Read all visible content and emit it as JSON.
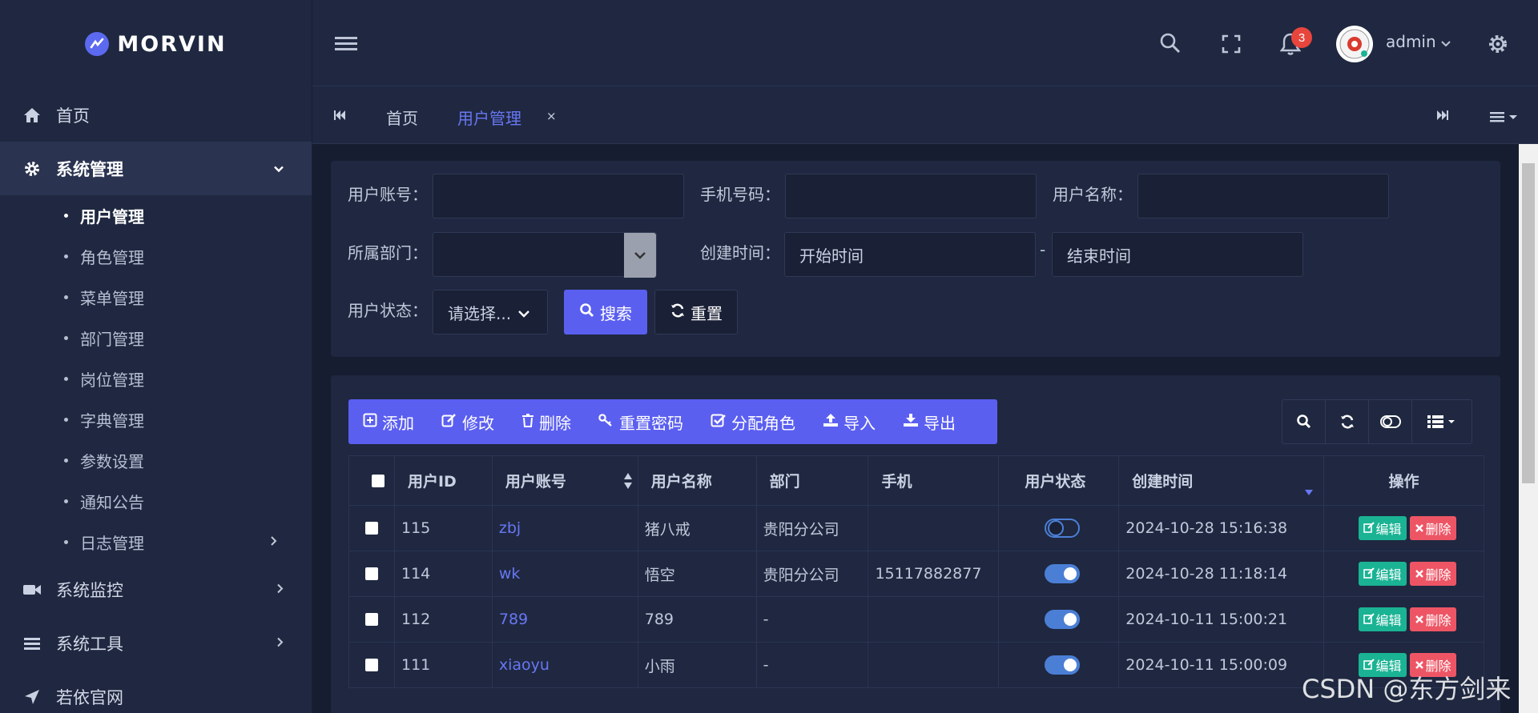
{
  "app": {
    "brand": "MORVIN",
    "accent_color": "#5b5ff0"
  },
  "sidebar": {
    "items": [
      {
        "label": "首页",
        "icon": "home-icon"
      },
      {
        "label": "系统管理",
        "icon": "gear-icon",
        "expanded": true,
        "children": [
          "用户管理",
          "角色管理",
          "菜单管理",
          "部门管理",
          "岗位管理",
          "字典管理",
          "参数设置",
          "通知公告",
          "日志管理"
        ]
      },
      {
        "label": "系统监控",
        "icon": "video-icon"
      },
      {
        "label": "系统工具",
        "icon": "list-icon"
      },
      {
        "label": "若依官网",
        "icon": "send-icon"
      }
    ]
  },
  "header": {
    "notification_count": "3",
    "user": "admin"
  },
  "tabs": {
    "home": "首页",
    "current": "用户管理",
    "close": "×"
  },
  "search": {
    "account_label": "用户账号：",
    "phone_label": "手机号码：",
    "name_label": "用户名称：",
    "dept_label": "所属部门：",
    "created_label": "创建时间：",
    "start_placeholder": "开始时间",
    "end_placeholder": "结束时间",
    "range_sep": "-",
    "status_label": "用户状态：",
    "status_value": "请选择...",
    "search_btn": "搜索",
    "reset_btn": "重置"
  },
  "toolbar": {
    "add": "添加",
    "edit": "修改",
    "delete": "删除",
    "reset_pwd": "重置密码",
    "assign_role": "分配角色",
    "import": "导入",
    "export": "导出"
  },
  "table": {
    "headers": [
      "用户ID",
      "用户账号",
      "用户名称",
      "部门",
      "手机",
      "用户状态",
      "创建时间",
      "操作"
    ],
    "rows": [
      {
        "id": "115",
        "account": "zbj",
        "name": "猪八戒",
        "dept": "贵阳分公司",
        "phone": "",
        "status": "off",
        "created": "2024-10-28 15:16:38"
      },
      {
        "id": "114",
        "account": "wk",
        "name": "悟空",
        "dept": "贵阳分公司",
        "phone": "15117882877",
        "status": "on",
        "created": "2024-10-28 11:18:14"
      },
      {
        "id": "112",
        "account": "789",
        "name": "789",
        "dept": "-",
        "phone": "",
        "status": "on",
        "created": "2024-10-11 15:00:21"
      },
      {
        "id": "111",
        "account": "xiaoyu",
        "name": "小雨",
        "dept": "-",
        "phone": "",
        "status": "on",
        "created": "2024-10-11 15:00:09"
      }
    ],
    "edit_btn": "编辑",
    "delete_btn": "删除"
  },
  "watermark": "CSDN @东方剑来"
}
